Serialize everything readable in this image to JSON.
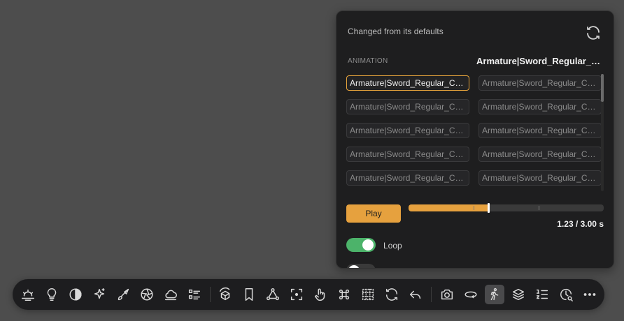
{
  "panel": {
    "header": "Changed from its defaults",
    "column_label": "ANIMATION",
    "column_header": "Armature|Sword_Regular_C...",
    "rows": [
      {
        "left": "Armature|Sword_Regular_Com...",
        "right": "Armature|Sword_Regular_Com..."
      },
      {
        "left": "Armature|Sword_Regular_Com...",
        "right": "Armature|Sword_Regular_Com..."
      },
      {
        "left": "Armature|Sword_Regular_Com...",
        "right": "Armature|Sword_Regular_Com..."
      },
      {
        "left": "Armature|Sword_Regular_Com...",
        "right": "Armature|Sword_Regular_Com..."
      },
      {
        "left": "Armature|Sword_Regular_Com...",
        "right": "Armature|Sword_Regular_Com..."
      }
    ],
    "selected_index": 0,
    "play_label": "Play",
    "time_readout": "1.23 / 3.00 s",
    "progress": 0.41,
    "loop_label": "Loop",
    "loop_on": true,
    "accent_color": "#e6a13e",
    "toggle_on_color": "#4cb36a"
  },
  "toolbar": {
    "icons": [
      "sunrise-icon",
      "lightbulb-icon",
      "contrast-icon",
      "sparkles-icon",
      "brush-icon",
      "aperture-icon",
      "cloud-icon",
      "list-icon",
      "cube-rotate-icon",
      "bookmark-icon",
      "vertices-icon",
      "focus-frame-icon",
      "hand-pointer-icon",
      "command-icon",
      "grid-dotted-icon",
      "refresh-icon",
      "undo-icon",
      "camera-icon",
      "rotate-3d-icon",
      "walk-icon",
      "layers-icon",
      "numbered-list-icon",
      "clock-search-icon",
      "more-icon"
    ],
    "active_icon": "walk-icon"
  }
}
